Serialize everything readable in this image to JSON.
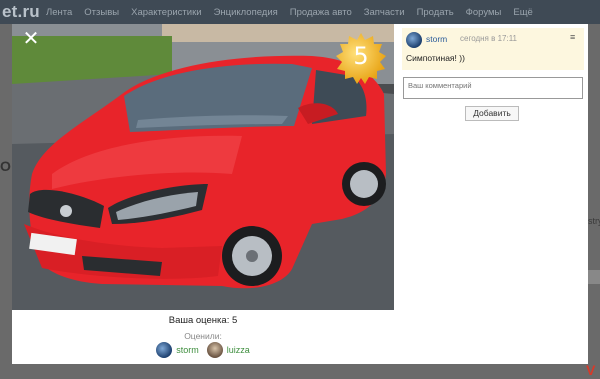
{
  "site": {
    "logo": "et.ru",
    "nav": [
      "Лента",
      "Отзывы",
      "Характеристики",
      "Энциклопедия",
      "Продажа авто",
      "Запчасти",
      "Продать",
      "Форумы",
      "Ещё"
    ],
    "side_letter": "О",
    "right_text": "stry",
    "corner_logo": "V"
  },
  "modal": {
    "close_icon": "close-icon",
    "rating_badge": "5",
    "rating_text": "Ваша оценка: 5",
    "rated_label": "Оценили:",
    "raters": [
      {
        "name": "storm"
      },
      {
        "name": "luizza"
      }
    ]
  },
  "comments": {
    "items": [
      {
        "author": "storm",
        "time": "сегодня в 17:11",
        "text": "Симпотиная! ))"
      }
    ],
    "input_placeholder": "Ваш комментарий",
    "submit_label": "Добавить"
  },
  "colors": {
    "car": "#e8242a",
    "comment_bg": "#fdf7df",
    "link": "#2b5c9a",
    "rater_link": "#3e8e3e"
  }
}
